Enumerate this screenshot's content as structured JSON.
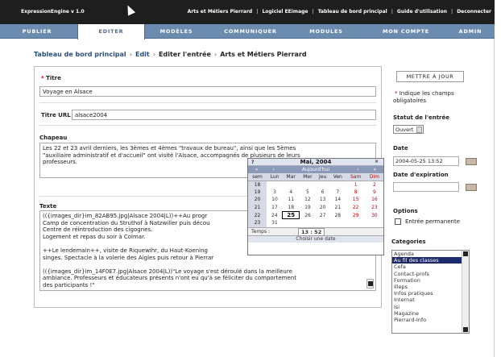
{
  "topbar": {
    "app_name": "ExpressionEngine v 1.0",
    "links": [
      "Arts et Métiers Pierrard",
      "Logiciel EEimage",
      "Tableau de bord principal",
      "Guide d'utilisation",
      "Deconnecter"
    ]
  },
  "nav": {
    "tabs": [
      "PUBLIER",
      "EDITER",
      "MODÈLES",
      "COMMUNIQUER",
      "MODULES",
      "MON COMPTE",
      "ADMIN"
    ],
    "active": "EDITER"
  },
  "breadcrumb": {
    "items": [
      "Tableau de bord principal",
      "Edit",
      "Editer l'entrée",
      "Arts et Métiers Pierrard"
    ],
    "separator": "›"
  },
  "form": {
    "title_label": "Titre",
    "required_mark": "*",
    "title_value": "Voyage en Alsace",
    "url_label": "Titre URL",
    "url_value": "alsace2004",
    "chapeau_label": "Chapeau",
    "chapeau_lines": [
      "Les 22 et 23 avril derniers, les 3èmes et 4èmes \"travaux de bureau\", ainsi que les 5èmes",
      "\"auxiliaire administratif et d'accueil\" ont visité l'Alsace, accompagnés de plusieurs de leurs",
      "professeurs."
    ],
    "texte_label": "Texte",
    "texte_lines": [
      "(({images_dir}im_82AB95.jpg|Alsace 2004|L))++Au progr",
      "Camp de concentration du Struthof à Natzwiller puis décou",
      "Centre de réintroduction des cigognes.",
      "Logement et repas du soir à Colmar.",
      "",
      "++Le lendemain++, visite de Riquewihr, du Haut-Koening",
      "singes. Spectacle à la volerie des Aigles puis retour à Pierrar",
      "",
      "(({images_dir}im_14F0E7.jpg|Alsace 2004|L))\"Le voyage s'est déroulé dans la meilleure",
      "ambiance. Professeurs et éducateurs présents n'ont eu qu'à se féliciter du comportement",
      "des participants !\""
    ]
  },
  "calendar": {
    "help": "?",
    "month": "Mai, 2004",
    "close": "×",
    "nav_prev2": "«",
    "nav_prev": "‹",
    "nav_today": "Aujourd'hui",
    "nav_next": "›",
    "nav_next2": "»",
    "headers": [
      "sem",
      "Lun",
      "Mar",
      "Mer",
      "Jeu",
      "Ven",
      "Sam",
      "Dim"
    ],
    "weeks": [
      [
        "18",
        "",
        "",
        "",
        "",
        "",
        "1",
        "2"
      ],
      [
        "19",
        "3",
        "4",
        "5",
        "6",
        "7",
        "8",
        "9"
      ],
      [
        "20",
        "10",
        "11",
        "12",
        "13",
        "14",
        "15",
        "16"
      ],
      [
        "21",
        "17",
        "18",
        "19",
        "20",
        "21",
        "22",
        "23"
      ],
      [
        "22",
        "24",
        "25",
        "26",
        "27",
        "28",
        "29",
        "30"
      ],
      [
        "23",
        "31",
        "",
        "",
        "",
        "",
        "",
        ""
      ]
    ],
    "selected_day": "25",
    "time_label": "Temps :",
    "time_value": "13 : 52",
    "footer": "Choisir une date"
  },
  "sidebar": {
    "update_button": "METTRE À JOUR",
    "required_note_mark": "*",
    "required_note_line1": "Indique les champs",
    "required_note_line2": "obligatoires",
    "status_label": "Statut de l'entrée",
    "status_value": "Ouvert",
    "date_label": "Date",
    "date_value": "2004-05-25 13:52",
    "expiration_label": "Date d'expiration",
    "expiration_value": "",
    "options_label": "Options",
    "permanent_label": "Entrée permanente",
    "categories_label": "Categories",
    "categories": [
      "Agenda",
      "Au fil des classes",
      "Cefa",
      "Contact-profs",
      "Formation",
      "Illeps",
      "Infos pratiques",
      "Internat",
      "Isi",
      "Magazine",
      "Pierrard-Info"
    ],
    "categories_selected": "Au fil des classes"
  },
  "colors": {
    "nav_bg": "#6b8cae",
    "link": "#2a4f7a",
    "required": "#cc0000",
    "list_selected": "#1d2b6e"
  }
}
